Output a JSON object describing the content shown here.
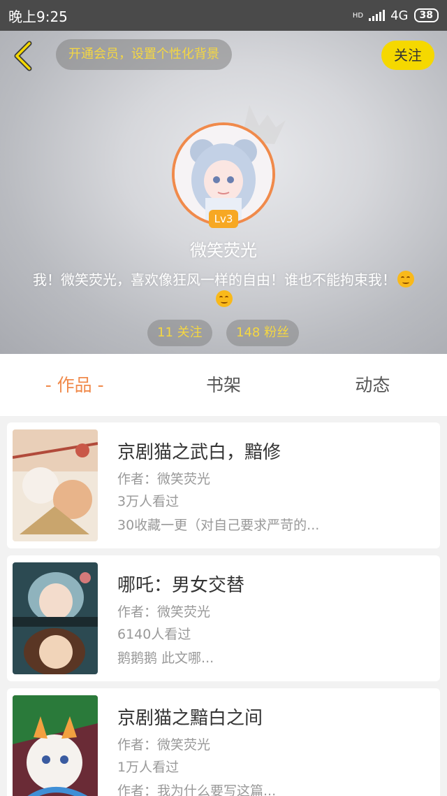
{
  "status_bar": {
    "time": "晚上9:25",
    "hd": "HD",
    "network": "4G",
    "battery": "38"
  },
  "header": {
    "vip_banner": "开通会员，设置个性化背景",
    "follow_label": "关注",
    "level": "Lv3",
    "nickname": "微笑荧光",
    "bio": "我！微笑荧光，喜欢像狂风一样的自由！谁也不能拘束我！",
    "following": "11 关注",
    "fans": "148 粉丝"
  },
  "tabs": [
    "- 作品 -",
    "书架",
    "动态"
  ],
  "works": [
    {
      "title": "京剧猫之武白，黯修",
      "author": "作者：微笑荧光",
      "views": "3万人看过",
      "desc": "30收藏一更（对自己要求严苛的..."
    },
    {
      "title": "哪吒：男女交替",
      "author": "作者：微笑荧光",
      "views": "6140人看过",
      "desc": "鹅鹅鹅 此文哪..."
    },
    {
      "title": "京剧猫之黯白之间",
      "author": "作者：微笑荧光",
      "views": "1万人看过",
      "desc": "作者：我为什么要写这篇..."
    }
  ]
}
